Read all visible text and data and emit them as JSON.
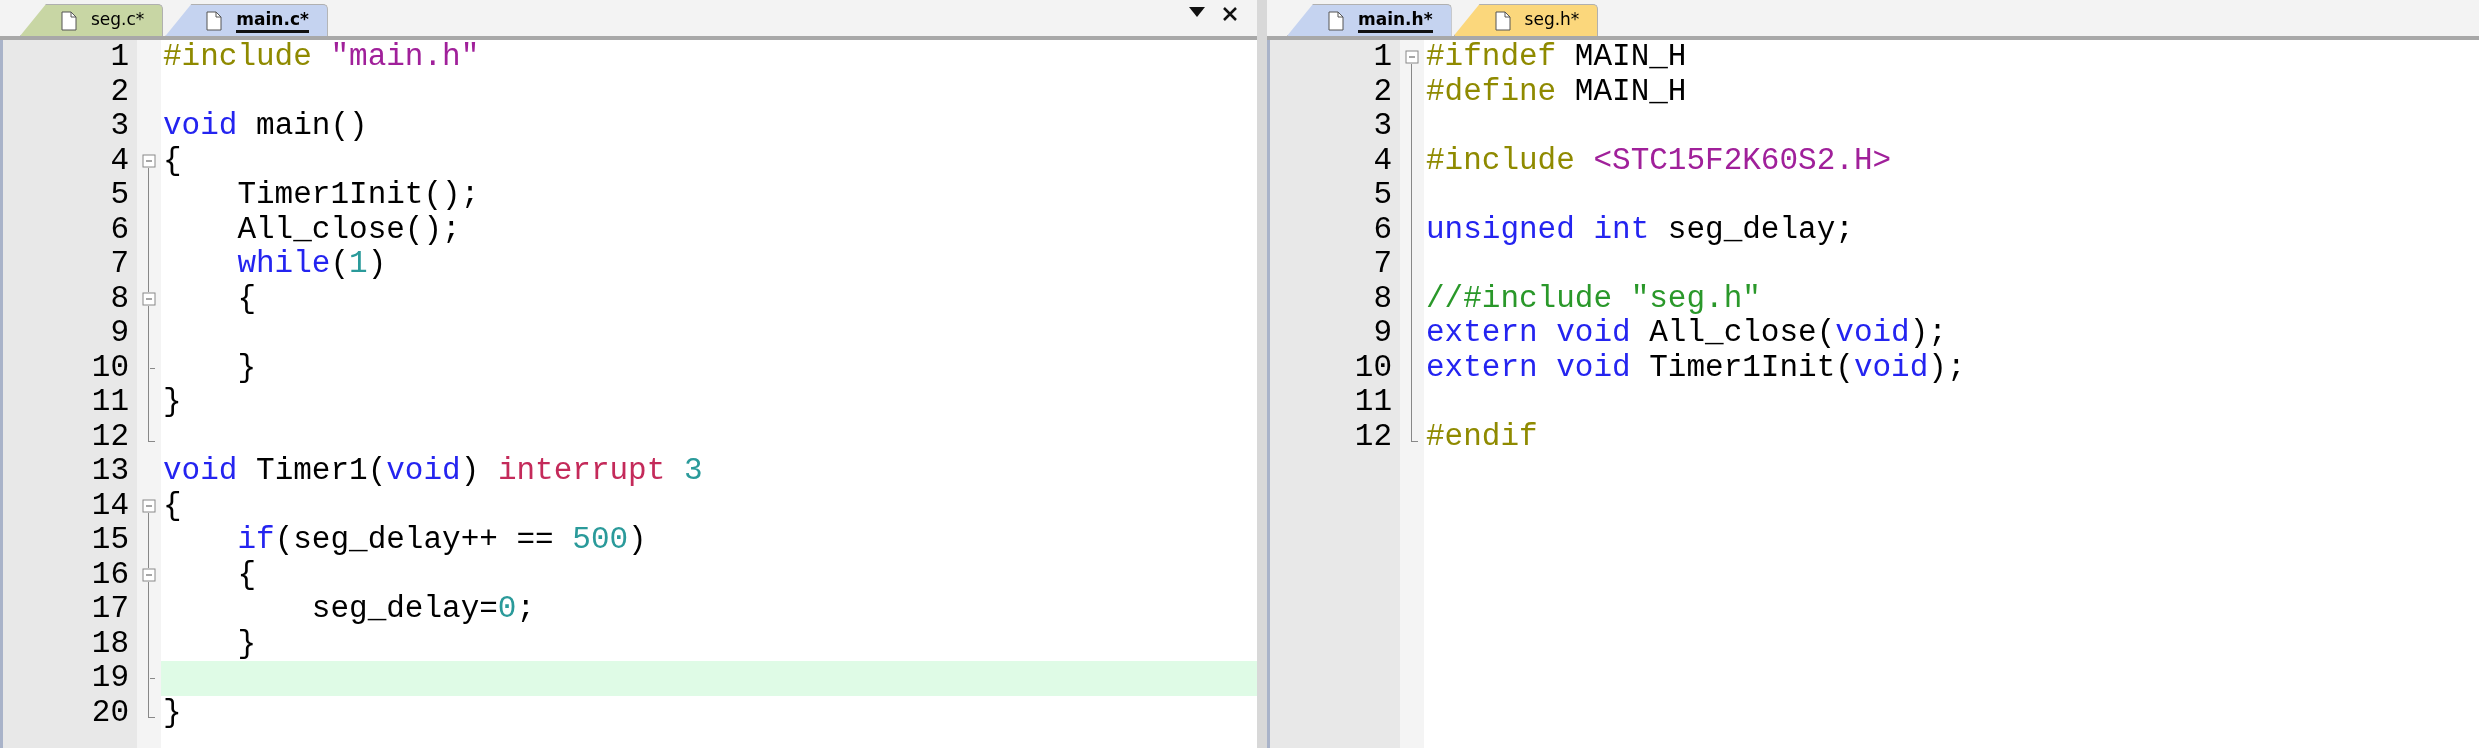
{
  "panes": [
    {
      "window_controls": true,
      "tabs": [
        {
          "label": "seg.c*",
          "selected": false,
          "color": "#c8d6a4"
        },
        {
          "label": "main.c*",
          "selected": true,
          "color": "#c5d3f0"
        }
      ],
      "lines": [
        {
          "number": "1",
          "tokens": [
            {
              "kind": "preprocessor",
              "text": "#include "
            },
            {
              "kind": "string",
              "text": "\"main.h\""
            }
          ]
        },
        {
          "number": "2"
        },
        {
          "number": "3",
          "tokens": [
            {
              "kind": "keyword",
              "text": "void"
            },
            {
              "kind": "plain",
              "text": " main()"
            }
          ]
        },
        {
          "number": "4",
          "collapsible": true,
          "tokens": [
            {
              "kind": "plain",
              "text": "{"
            }
          ]
        },
        {
          "number": "5",
          "tokens": [
            {
              "kind": "plain",
              "text": "    Timer1Init();"
            }
          ]
        },
        {
          "number": "6",
          "tokens": [
            {
              "kind": "plain",
              "text": "    All_close();"
            }
          ]
        },
        {
          "number": "7",
          "tokens": [
            {
              "kind": "keyword",
              "text": "    while"
            },
            {
              "kind": "plain",
              "text": "("
            },
            {
              "kind": "number",
              "text": "1"
            },
            {
              "kind": "plain",
              "text": ")"
            }
          ]
        },
        {
          "number": "8",
          "collapsible": true,
          "tokens": [
            {
              "kind": "plain",
              "text": "    {"
            }
          ]
        },
        {
          "number": "9"
        },
        {
          "number": "10",
          "fold_end": true,
          "tokens": [
            {
              "kind": "plain",
              "text": "    }"
            }
          ]
        },
        {
          "number": "11",
          "tokens": [
            {
              "kind": "plain",
              "text": "}"
            }
          ]
        },
        {
          "number": "12",
          "fold_end": true
        },
        {
          "number": "13",
          "tokens": [
            {
              "kind": "keyword",
              "text": "void"
            },
            {
              "kind": "plain",
              "text": " Timer1("
            },
            {
              "kind": "keyword",
              "text": "void"
            },
            {
              "kind": "plain",
              "text": ") "
            },
            {
              "kind": "modifier",
              "text": "interrupt"
            },
            {
              "kind": "number",
              "text": " 3"
            }
          ]
        },
        {
          "number": "14",
          "collapsible": true,
          "tokens": [
            {
              "kind": "plain",
              "text": "{"
            }
          ]
        },
        {
          "number": "15",
          "tokens": [
            {
              "kind": "keyword",
              "text": "    if"
            },
            {
              "kind": "plain",
              "text": "(seg_delay++ == "
            },
            {
              "kind": "number",
              "text": "500"
            },
            {
              "kind": "plain",
              "text": ")"
            }
          ]
        },
        {
          "number": "16",
          "collapsible": true,
          "tokens": [
            {
              "kind": "plain",
              "text": "    {"
            }
          ]
        },
        {
          "number": "17",
          "tokens": [
            {
              "kind": "plain",
              "text": "        seg_delay="
            },
            {
              "kind": "number",
              "text": "0"
            },
            {
              "kind": "plain",
              "text": ";"
            }
          ]
        },
        {
          "number": "18",
          "tokens": [
            {
              "kind": "plain",
              "text": "    }"
            }
          ]
        },
        {
          "number": "19",
          "fold_end": true,
          "current": true
        },
        {
          "number": "20",
          "fold_end": true,
          "tokens": [
            {
              "kind": "plain",
              "text": "}"
            }
          ]
        }
      ]
    },
    {
      "tabs": [
        {
          "label": "main.h*",
          "selected": true,
          "color": "#c5d3f0"
        },
        {
          "label": "seg.h*",
          "selected": false,
          "color": "#fbd77c"
        }
      ],
      "lines": [
        {
          "number": "1",
          "collapsible": true,
          "tokens": [
            {
              "kind": "preprocessor",
              "text": "#ifndef"
            },
            {
              "kind": "plain",
              "text": " MAIN_H"
            }
          ]
        },
        {
          "number": "2",
          "tokens": [
            {
              "kind": "preprocessor",
              "text": "#define"
            },
            {
              "kind": "plain",
              "text": " MAIN_H"
            }
          ]
        },
        {
          "number": "3"
        },
        {
          "number": "4",
          "tokens": [
            {
              "kind": "preprocessor",
              "text": "#include "
            },
            {
              "kind": "string",
              "text": "<STC15F2K60S2.H>"
            }
          ]
        },
        {
          "number": "5"
        },
        {
          "number": "6",
          "tokens": [
            {
              "kind": "keyword",
              "text": "unsigned int"
            },
            {
              "kind": "plain",
              "text": " seg_delay;"
            }
          ]
        },
        {
          "number": "7"
        },
        {
          "number": "8",
          "tokens": [
            {
              "kind": "comment",
              "text": "//#include \"seg.h\""
            }
          ]
        },
        {
          "number": "9",
          "tokens": [
            {
              "kind": "keyword",
              "text": "extern void"
            },
            {
              "kind": "plain",
              "text": " All_close("
            },
            {
              "kind": "keyword",
              "text": "void"
            },
            {
              "kind": "plain",
              "text": ");"
            }
          ]
        },
        {
          "number": "10",
          "tokens": [
            {
              "kind": "keyword",
              "text": "extern void"
            },
            {
              "kind": "plain",
              "text": " Timer1Init("
            },
            {
              "kind": "keyword",
              "text": "void"
            },
            {
              "kind": "plain",
              "text": ");"
            }
          ]
        },
        {
          "number": "11"
        },
        {
          "number": "12",
          "fold_end": true,
          "tokens": [
            {
              "kind": "preprocessor",
              "text": "#endif"
            }
          ]
        }
      ]
    }
  ]
}
